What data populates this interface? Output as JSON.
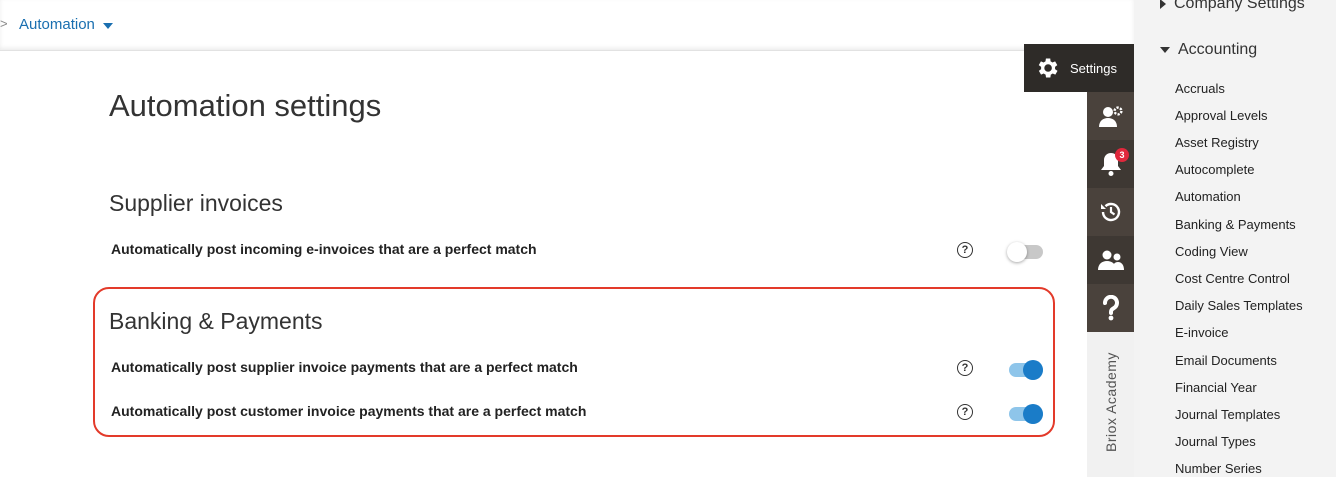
{
  "breadcrumb": {
    "separator": ">",
    "current": "Automation"
  },
  "page": {
    "title": "Automation settings"
  },
  "sections": {
    "supplier": {
      "title": "Supplier invoices",
      "rows": [
        {
          "label": "Automatically post incoming e-invoices that are a perfect match",
          "help": "?",
          "enabled": false
        }
      ]
    },
    "banking": {
      "title": "Banking & Payments",
      "rows": [
        {
          "label": "Automatically post supplier invoice payments that are a perfect match",
          "help": "?",
          "enabled": true
        },
        {
          "label": "Automatically post customer invoice payments that are a perfect match",
          "help": "?",
          "enabled": true
        }
      ]
    }
  },
  "toolbar": {
    "settings_label": "Settings",
    "notification_count": "3",
    "academy_label": "Briox Academy",
    "icons": [
      "gear-icon",
      "user-settings-icon",
      "bell-icon",
      "history-icon",
      "users-icon",
      "question-icon"
    ]
  },
  "side_panel": {
    "groups": [
      {
        "label": "Company Settings",
        "expanded": false
      },
      {
        "label": "Accounting",
        "expanded": true
      }
    ],
    "items": [
      "Accruals",
      "Approval Levels",
      "Asset Registry",
      "Autocomplete",
      "Automation",
      "Banking & Payments",
      "Coding View",
      "Cost Centre Control",
      "Daily Sales Templates",
      "E-invoice",
      "Email Documents",
      "Financial Year",
      "Journal Templates",
      "Journal Types",
      "Number Series"
    ]
  },
  "colors": {
    "accent": "#1a7cc8",
    "link": "#1a6fb0",
    "highlight": "#e33a2a",
    "toolbar_dark": "#2e2b28",
    "toolbar": "#4a423c",
    "badge": "#e0283c"
  }
}
